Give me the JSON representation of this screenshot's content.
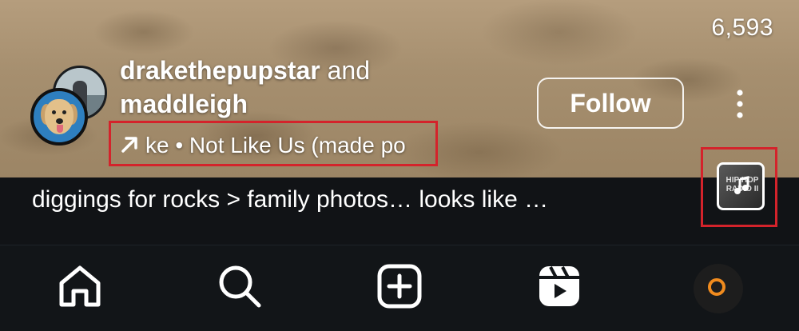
{
  "video": {
    "view_count": "6,593",
    "user_primary": "drakethepupstar",
    "user_connector": "and",
    "user_secondary": "maddleigh",
    "audio_text": "ke • Not Like Us (made po",
    "follow_label": "Follow"
  },
  "caption": {
    "text": "diggings for rocks > family photos… looks like …"
  },
  "music": {
    "thumbnail_text": "HIP HOP RADIO II"
  },
  "nav": {
    "items": [
      {
        "name": "home",
        "icon": "home-icon"
      },
      {
        "name": "search",
        "icon": "search-icon"
      },
      {
        "name": "create",
        "icon": "plus-square-icon"
      },
      {
        "name": "reels",
        "icon": "reels-icon"
      },
      {
        "name": "profile",
        "icon": "profile-avatar"
      }
    ]
  },
  "colors": {
    "highlight_border": "#d4232b",
    "nav_background": "#121518",
    "profile_ring": "#f08b1e"
  }
}
